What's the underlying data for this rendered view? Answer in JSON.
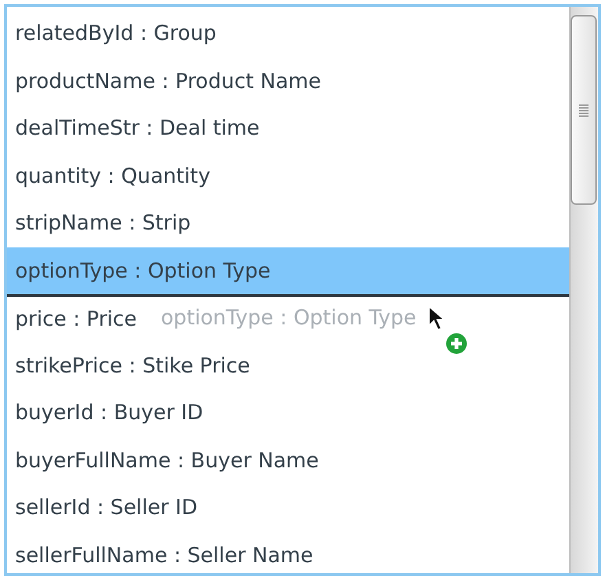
{
  "list": {
    "rows": [
      {
        "label": "relatedById : Group",
        "selected": false,
        "drop_indicator": false
      },
      {
        "label": "productName : Product Name",
        "selected": false,
        "drop_indicator": false
      },
      {
        "label": "dealTimeStr : Deal time",
        "selected": false,
        "drop_indicator": false
      },
      {
        "label": "quantity : Quantity",
        "selected": false,
        "drop_indicator": false
      },
      {
        "label": "stripName : Strip",
        "selected": false,
        "drop_indicator": false
      },
      {
        "label": "optionType : Option Type",
        "selected": true,
        "drop_indicator": false
      },
      {
        "label": "price : Price",
        "selected": false,
        "drop_indicator": true
      },
      {
        "label": "strikePrice : Stike Price",
        "selected": false,
        "drop_indicator": false
      },
      {
        "label": "buyerId : Buyer ID",
        "selected": false,
        "drop_indicator": false
      },
      {
        "label": "buyerFullName : Buyer Name",
        "selected": false,
        "drop_indicator": false
      },
      {
        "label": "sellerId : Seller ID",
        "selected": false,
        "drop_indicator": false
      },
      {
        "label": "sellerFullName : Seller Name",
        "selected": false,
        "drop_indicator": false
      }
    ]
  },
  "drag": {
    "ghost_label": "optionType : Option Type"
  }
}
